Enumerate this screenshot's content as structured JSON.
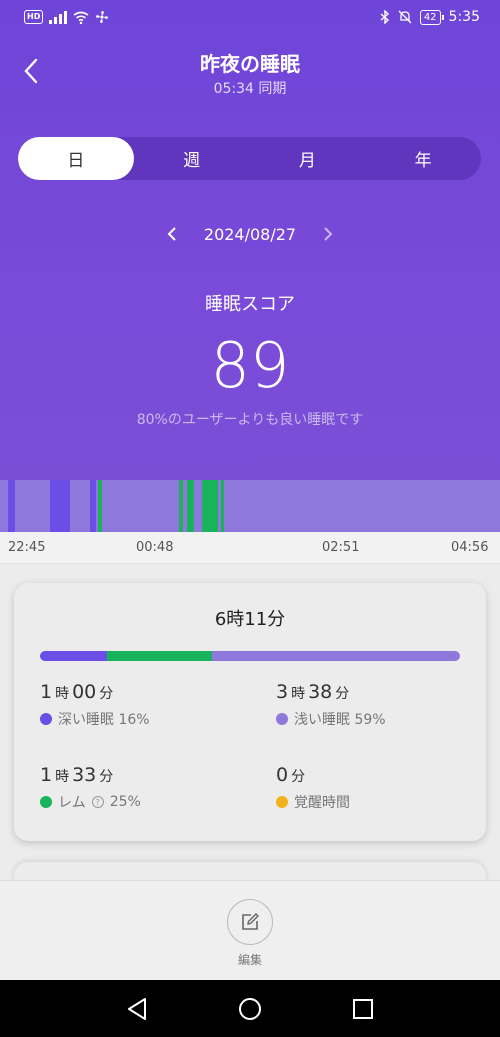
{
  "status_bar": {
    "hd_badge": "HD",
    "battery": "42",
    "time": "5:35"
  },
  "header": {
    "title": "昨夜の睡眠",
    "subtitle": "05:34 同期"
  },
  "tabs": [
    {
      "label": "日",
      "active": true
    },
    {
      "label": "週",
      "active": false
    },
    {
      "label": "月",
      "active": false
    },
    {
      "label": "年",
      "active": false
    }
  ],
  "date_nav": {
    "date": "2024/08/27"
  },
  "score": {
    "label": "睡眠スコア",
    "value": "89",
    "note": "80%のユーザーよりも良い睡眠です"
  },
  "colors": {
    "deep": "#6a4ee6",
    "light": "#8f78dc",
    "rem": "#18b35a",
    "awake": "#f2b21c"
  },
  "timeline": {
    "start_label": "22:45",
    "end_label": "04:56",
    "ticks": [
      "22:45",
      "00:48",
      "02:51",
      "04:56"
    ],
    "segments": [
      {
        "stage": "light",
        "start": "22:45",
        "end": "22:51"
      },
      {
        "stage": "deep",
        "start": "22:51",
        "end": "22:56"
      },
      {
        "stage": "light",
        "start": "22:56",
        "end": "23:22"
      },
      {
        "stage": "deep",
        "start": "23:22",
        "end": "23:37"
      },
      {
        "stage": "light",
        "start": "23:37",
        "end": "23:52"
      },
      {
        "stage": "deep",
        "start": "23:52",
        "end": "23:56"
      },
      {
        "stage": "light",
        "start": "23:56",
        "end": "23:58"
      },
      {
        "stage": "rem",
        "start": "23:58",
        "end": "00:01"
      },
      {
        "stage": "light",
        "start": "00:01",
        "end": "00:58"
      },
      {
        "stage": "rem",
        "start": "00:58",
        "end": "01:01"
      },
      {
        "stage": "light",
        "start": "01:01",
        "end": "01:04"
      },
      {
        "stage": "rem",
        "start": "01:04",
        "end": "01:09"
      },
      {
        "stage": "light",
        "start": "01:09",
        "end": "01:15"
      },
      {
        "stage": "rem",
        "start": "01:15",
        "end": "01:27"
      },
      {
        "stage": "light",
        "start": "01:27",
        "end": "01:29"
      },
      {
        "stage": "rem",
        "start": "01:29",
        "end": "01:31"
      },
      {
        "stage": "light",
        "start": "01:31",
        "end": "04:56"
      }
    ]
  },
  "summary": {
    "total": "6時11分",
    "bar_fractions": {
      "deep": 0.16,
      "rem": 0.25,
      "light": 0.59
    },
    "hour_unit": "時",
    "minute_unit": "分",
    "deep": {
      "hours": "1",
      "minutes": "00",
      "label": "深い睡眠 16%"
    },
    "light": {
      "hours": "3",
      "minutes": "38",
      "label": "浅い睡眠 59%"
    },
    "rem": {
      "hours": "1",
      "minutes": "33",
      "label": "レム",
      "percent": "25%"
    },
    "awake": {
      "minutes": "0",
      "label": "覚醒時間"
    }
  },
  "edit": {
    "label": "編集"
  }
}
